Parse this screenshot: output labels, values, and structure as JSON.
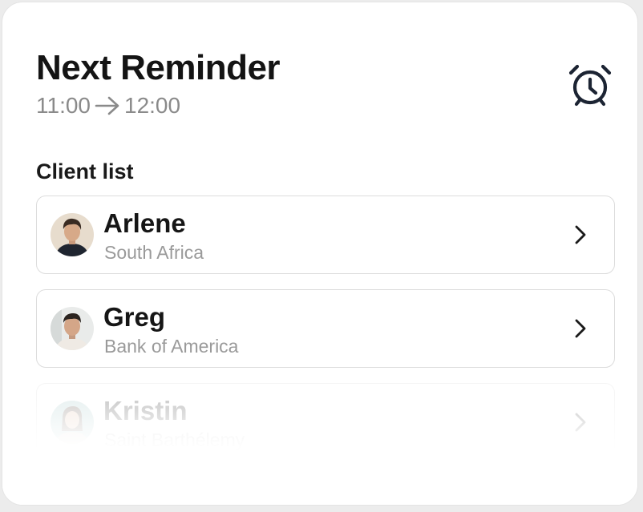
{
  "header": {
    "title": "Next Reminder",
    "time_start": "11:00",
    "time_end": "12:00",
    "arrow_icon": "arrow-right-icon",
    "alarm_icon": "alarm-clock-icon"
  },
  "client_list": {
    "label": "Client list",
    "items": [
      {
        "name": "Arlene",
        "organization": "South Africa",
        "avatar_icon": "avatar-arlene",
        "chevron_icon": "chevron-right-icon"
      },
      {
        "name": "Greg",
        "organization": "Bank of America",
        "avatar_icon": "avatar-greg",
        "chevron_icon": "chevron-right-icon"
      },
      {
        "name": "Kristin",
        "organization": "Saint Barthélemy",
        "avatar_icon": "avatar-kristin",
        "chevron_icon": "chevron-right-icon"
      }
    ]
  },
  "colors": {
    "title": "#141414",
    "muted_text": "#8a8a8a",
    "row_border": "#dcdcdc",
    "icon_dark": "#1c2433"
  }
}
